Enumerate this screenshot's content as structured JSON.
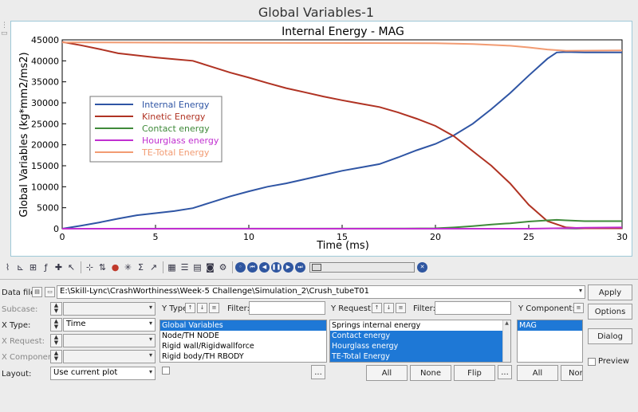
{
  "window": {
    "title": "Global Variables-1"
  },
  "chart_data": {
    "type": "line",
    "title": "Internal Energy - MAG",
    "xlabel": "Time (ms)",
    "ylabel": "Global Variables (kg*mm2/ms2)",
    "xlim": [
      0,
      30
    ],
    "ylim": [
      0,
      45000
    ],
    "xticks": [
      0,
      5,
      10,
      15,
      20,
      25,
      30
    ],
    "yticks": [
      0,
      5000,
      10000,
      15000,
      20000,
      25000,
      30000,
      35000,
      40000,
      45000
    ],
    "legend_position": "upper-left",
    "grid": false,
    "series": [
      {
        "name": "Internal Energy",
        "color": "#2f55a4",
        "points": [
          [
            0,
            0
          ],
          [
            1,
            700
          ],
          [
            2,
            1500
          ],
          [
            3,
            2400
          ],
          [
            4,
            3200
          ],
          [
            5,
            3700
          ],
          [
            6,
            4200
          ],
          [
            7,
            4900
          ],
          [
            8,
            6300
          ],
          [
            9,
            7700
          ],
          [
            10,
            8900
          ],
          [
            11,
            10000
          ],
          [
            12,
            10800
          ],
          [
            13,
            11800
          ],
          [
            14,
            12800
          ],
          [
            15,
            13800
          ],
          [
            16,
            14600
          ],
          [
            17,
            15400
          ],
          [
            18,
            17000
          ],
          [
            19,
            18700
          ],
          [
            20,
            20200
          ],
          [
            21,
            22300
          ],
          [
            22,
            25000
          ],
          [
            23,
            28500
          ],
          [
            24,
            32300
          ],
          [
            25,
            36500
          ],
          [
            26,
            40500
          ],
          [
            26.5,
            42000
          ],
          [
            27,
            42100
          ],
          [
            28,
            42000
          ],
          [
            30,
            42000
          ]
        ]
      },
      {
        "name": "Kinetic Energy",
        "color": "#b03323",
        "points": [
          [
            0,
            44500
          ],
          [
            1,
            43700
          ],
          [
            2,
            42800
          ],
          [
            3,
            41800
          ],
          [
            4,
            41300
          ],
          [
            5,
            40800
          ],
          [
            6,
            40400
          ],
          [
            7,
            40000
          ],
          [
            8,
            38600
          ],
          [
            9,
            37200
          ],
          [
            10,
            36000
          ],
          [
            11,
            34700
          ],
          [
            12,
            33500
          ],
          [
            13,
            32500
          ],
          [
            14,
            31500
          ],
          [
            15,
            30600
          ],
          [
            16,
            29800
          ],
          [
            17,
            29000
          ],
          [
            18,
            27700
          ],
          [
            19,
            26200
          ],
          [
            20,
            24500
          ],
          [
            21,
            22000
          ],
          [
            22,
            18500
          ],
          [
            23,
            15000
          ],
          [
            24,
            10800
          ],
          [
            25,
            5700
          ],
          [
            26,
            1800
          ],
          [
            27,
            300
          ],
          [
            28,
            100
          ],
          [
            30,
            100
          ]
        ]
      },
      {
        "name": "Contact energy",
        "color": "#3f8a3a",
        "points": [
          [
            0,
            0
          ],
          [
            18,
            30
          ],
          [
            20,
            100
          ],
          [
            21,
            300
          ],
          [
            22,
            600
          ],
          [
            23,
            1000
          ],
          [
            24,
            1300
          ],
          [
            25,
            1700
          ],
          [
            26,
            2000
          ],
          [
            26.5,
            2100
          ],
          [
            27,
            2000
          ],
          [
            28,
            1800
          ],
          [
            30,
            1800
          ]
        ]
      },
      {
        "name": "Hourglass energy",
        "color": "#c02fd0",
        "points": [
          [
            0,
            0
          ],
          [
            25,
            0
          ],
          [
            26,
            80
          ],
          [
            27,
            150
          ],
          [
            28,
            250
          ],
          [
            30,
            300
          ]
        ]
      },
      {
        "name": "TE-Total Energy",
        "color": "#f29b72",
        "points": [
          [
            0,
            44400
          ],
          [
            10,
            44300
          ],
          [
            20,
            44200
          ],
          [
            22,
            44000
          ],
          [
            24,
            43600
          ],
          [
            25,
            43200
          ],
          [
            26,
            42700
          ],
          [
            27,
            42400
          ],
          [
            30,
            42500
          ]
        ]
      }
    ]
  },
  "toolbar": {
    "icons": [
      "curve-edit-icon",
      "axis-icon",
      "plot-macros-icon",
      "math-fx-icon",
      "add-point-icon",
      "pointer-icon",
      "cross-icon",
      "scale-icon",
      "color-wheel-icon",
      "star-icon",
      "sum-icon",
      "trend-icon",
      "table-icon",
      "list-icon",
      "note-icon",
      "camera-icon",
      "settings-icon"
    ],
    "animation": [
      "options-icon",
      "first-frame-icon",
      "prev-frame-icon",
      "pause-icon",
      "next-frame-icon",
      "last-frame-icon"
    ]
  },
  "panel": {
    "data_file_label": "Data file:",
    "data_file_path": "E:\\Skill-Lync\\CrashWorthiness\\Week-5 Challenge\\Simulation_2\\Crush_tubeT01",
    "apply_label": "Apply",
    "options_label": "Options",
    "dialog_label": "Dialog",
    "preview_label": "Preview",
    "subcase_label": "Subcase:",
    "x_type_label": "X Type:",
    "x_type_value": "Time",
    "x_request_label": "X Request:",
    "x_component_label": "X Component:",
    "layout_label": "Layout:",
    "layout_value": "Use current plot",
    "y_type_label": "Y Type:",
    "y_request_label": "Y Request:",
    "y_component_label": "Y Component:",
    "filter_label": "Filter:",
    "y_types": [
      {
        "label": "Global Variables",
        "selected": true
      },
      {
        "label": "Node/TH NODE",
        "selected": false
      },
      {
        "label": "Rigid wall/Rigidwallforce",
        "selected": false
      },
      {
        "label": "Rigid body/TH RBODY",
        "selected": false
      }
    ],
    "y_requests": [
      {
        "label": "Springs internal energy",
        "selected": false
      },
      {
        "label": "Contact energy",
        "selected": true
      },
      {
        "label": "Hourglass energy",
        "selected": true
      },
      {
        "label": "TE-Total Energy",
        "selected": true
      }
    ],
    "y_components": [
      {
        "label": "MAG",
        "selected": true
      }
    ],
    "ellipsis": "...",
    "all_label": "All",
    "none_label": "None",
    "flip_label": "Flip",
    "none_truncated": "Nor"
  }
}
